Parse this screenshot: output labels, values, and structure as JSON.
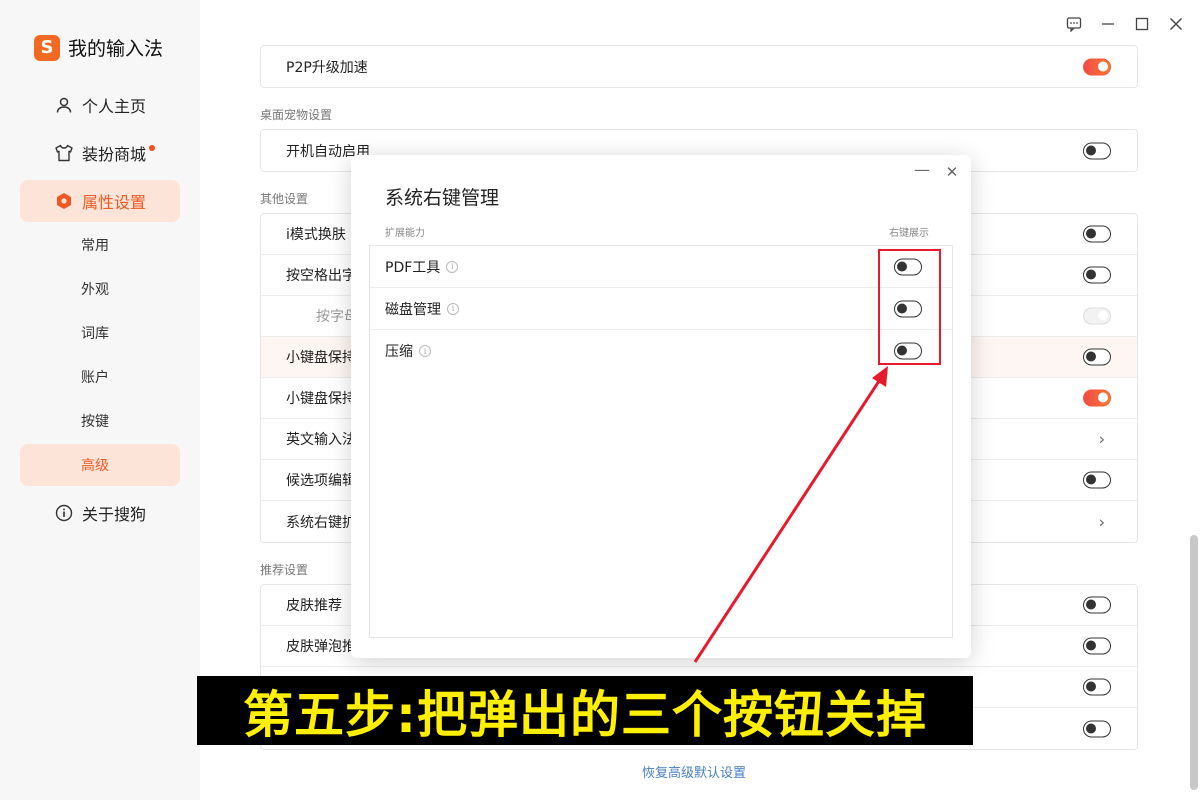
{
  "app": {
    "title": "我的输入法",
    "logo_letter": "S"
  },
  "sidebar": {
    "items": [
      {
        "label": "个人主页",
        "icon": "person-icon"
      },
      {
        "label": "装扮商城",
        "icon": "shirt-icon",
        "badge_dot": true
      },
      {
        "label": "属性设置",
        "icon": "hexagon-settings-icon",
        "active": true
      },
      {
        "label": "关于搜狗",
        "icon": "info-icon"
      }
    ],
    "subitems": [
      {
        "label": "常用"
      },
      {
        "label": "外观"
      },
      {
        "label": "词库"
      },
      {
        "label": "账户"
      },
      {
        "label": "按键"
      },
      {
        "label": "高级",
        "active": true
      }
    ]
  },
  "main": {
    "sections": [
      {
        "label": "",
        "rows": [
          {
            "label": "P2P升级加速",
            "control": "toggle",
            "state": "on"
          }
        ]
      },
      {
        "label": "桌面宠物设置",
        "rows": [
          {
            "label": "开机自动启用",
            "control": "toggle",
            "state": "off"
          }
        ]
      },
      {
        "label": "其他设置",
        "rows": [
          {
            "label": "i模式换肤",
            "control": "toggle",
            "state": "off"
          },
          {
            "label": "按空格出字",
            "control": "toggle",
            "state": "off"
          },
          {
            "label": "按字母",
            "control": "toggle",
            "state": "disabled",
            "indent": true
          },
          {
            "label": "小键盘保持",
            "control": "toggle",
            "state": "off",
            "hover": true
          },
          {
            "label": "小键盘保持",
            "control": "toggle",
            "state": "on"
          },
          {
            "label": "英文输入法",
            "control": "chevron"
          },
          {
            "label": "候选项编辑",
            "control": "toggle",
            "state": "off"
          },
          {
            "label": "系统右键扩",
            "control": "chevron"
          }
        ]
      },
      {
        "label": "推荐设置",
        "rows": [
          {
            "label": "皮肤推荐",
            "control": "toggle",
            "state": "off"
          },
          {
            "label": "皮肤弹泡推",
            "control": "toggle",
            "state": "off"
          },
          {
            "label": "",
            "control": "toggle",
            "state": "off"
          },
          {
            "label": "",
            "control": "toggle",
            "state": "off"
          }
        ]
      }
    ],
    "restore_link": "恢复高级默认设置"
  },
  "dialog": {
    "title": "系统右键管理",
    "col_left": "扩展能力",
    "col_right": "右键展示",
    "rows": [
      {
        "label": "PDF工具",
        "state": "off"
      },
      {
        "label": "磁盘管理",
        "state": "off"
      },
      {
        "label": "压缩",
        "state": "off"
      }
    ]
  },
  "caption": {
    "text": "第五步:把弹出的三个按钮关掉"
  },
  "colors": {
    "accent": "#f05a22",
    "active_bg": "#fde4d8",
    "annotation_red": "#e8192c",
    "caption_yellow": "#ffef00"
  }
}
